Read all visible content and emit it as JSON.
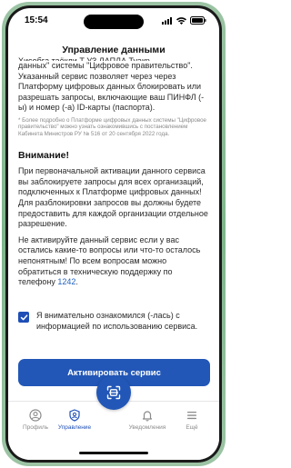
{
  "status_bar": {
    "time": "15:54"
  },
  "header": {
    "title": "Управление данными"
  },
  "content": {
    "intro_top_cut": "Ҳисобға таёқли Т УЗ ЛАПЛА Туақр",
    "intro": "данных\" системы \"Цифровое правительство\". Указанный сервис позволяет через через Платформу цифровых данных блокировать или разрешать запросы, включающие ваш ПИНФЛ (-ы) и номер (-а) ID-карты (паспорта).",
    "footnote": "* Более подробно о Платформе цифровых данных системы \"Цифровое правительство\" можно узнать ознакомившись с постановлением Кабинета Министров РУ № 516 от 20 сентября 2022 года.",
    "warning_title": "Внимание!",
    "warning_text": "При первоначальной активации данного сервиса вы заблокируете запросы для всех организаций, подключенных к Платформе цифровых данных! Для разблокировки запросов вы должны будете предоставить для каждой организации отдельное разрешение.",
    "warning_text2_pre": "Не активируйте данный сервис если у вас остались какие-то вопросы или что-то осталось непонятным! По всем вопросам можно обратиться в техническую поддержку по телефону ",
    "support_phone": "1242",
    "warning_text2_post": "."
  },
  "consent": {
    "checked": true,
    "label": "Я внимательно ознакомился (-лась) с информацией по использованию сервиса."
  },
  "activate_button": {
    "label": "Активировать сервис"
  },
  "bottom_nav": {
    "items": [
      {
        "label": "Профиль",
        "icon": "profile-icon",
        "active": false
      },
      {
        "label": "Управление",
        "icon": "shield-user-icon",
        "active": true
      },
      {
        "label": "Уведомления",
        "icon": "bell-icon",
        "active": false
      },
      {
        "label": "Ещё",
        "icon": "menu-icon",
        "active": false
      }
    ],
    "fab_icon": "scan-icon"
  },
  "colors": {
    "accent": "#2257b7",
    "frame": "#8fbd98"
  }
}
